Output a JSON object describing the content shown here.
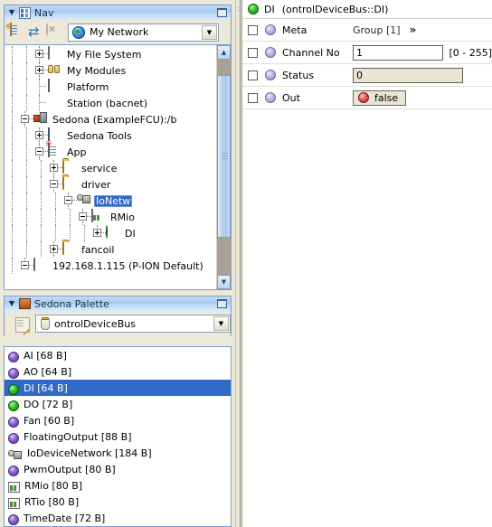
{
  "nav_panel": {
    "title": "Nav",
    "collapse_icon": "triangle-down-icon",
    "panel_icon": "nav-panel-icon",
    "maximize_icon": "maximize-icon",
    "toolbar": {
      "bookmark_icon": "bookmark-page-icon",
      "refresh_icon": "refresh-icon",
      "stop_icon": "stop-disabled-icon"
    },
    "location_combo": {
      "icon": "globe-icon",
      "value": "My Network",
      "arrow_icon": "chevron-down-icon"
    },
    "tree": [
      {
        "label": "My File System",
        "indent": 2,
        "expander": "plus",
        "icon": "drive-icon",
        "selected": false
      },
      {
        "label": "My Modules",
        "indent": 2,
        "expander": "plus",
        "icon": "modules-icon",
        "selected": false
      },
      {
        "label": "Platform",
        "indent": 2,
        "expander": "none",
        "icon": "stack-icon",
        "selected": false
      },
      {
        "label": "Station (bacnet)",
        "indent": 2,
        "expander": "none",
        "icon": "fox-icon",
        "selected": false
      },
      {
        "label": "Sedona (ExampleFCU):/b",
        "indent": 1,
        "expander": "minus",
        "icon": "sedona-icon",
        "selected": false
      },
      {
        "label": "Sedona Tools",
        "indent": 2,
        "expander": "plus",
        "icon": "stack-blue-icon",
        "selected": false
      },
      {
        "label": "App",
        "indent": 2,
        "expander": "minus",
        "icon": "app-icon",
        "selected": false
      },
      {
        "label": "service",
        "indent": 3,
        "expander": "plus",
        "icon": "folder-icon",
        "selected": false
      },
      {
        "label": "driver",
        "indent": 3,
        "expander": "minus",
        "icon": "folder-icon",
        "selected": false
      },
      {
        "label": "IoNetw",
        "indent": 4,
        "expander": "minus",
        "icon": "network-icon",
        "selected": true
      },
      {
        "label": "RMio",
        "indent": 5,
        "expander": "minus",
        "icon": "rmio-icon",
        "selected": false
      },
      {
        "label": "DI",
        "indent": 6,
        "expander": "plus",
        "icon": "green-dot-icon",
        "selected": false
      },
      {
        "label": "fancoil",
        "indent": 3,
        "expander": "plus",
        "icon": "folder-icon",
        "selected": false
      },
      {
        "label": "192.168.1.115 (P-ION Default)",
        "indent": 1,
        "expander": "minus",
        "icon": "printer-icon",
        "selected": false
      }
    ],
    "scrollbar": {
      "up_arrow": "scroll-up-icon",
      "down_arrow": "scroll-down-icon"
    }
  },
  "palette_panel": {
    "title": "Sedona Palette",
    "collapse_icon": "triangle-down-icon",
    "panel_icon": "palette-icon",
    "maximize_icon": "maximize-icon",
    "open_icon": "open-palette-icon",
    "kit_combo": {
      "icon": "kit-icon",
      "value": "ontrolDeviceBus",
      "arrow_icon": "chevron-down-icon"
    },
    "items": [
      {
        "label": "AI [68 B]",
        "icon": "purple-dot-icon",
        "selected": false
      },
      {
        "label": "AO [64 B]",
        "icon": "purple-dot-icon",
        "selected": false
      },
      {
        "label": "DI [64 B]",
        "icon": "green-dot-icon",
        "selected": true
      },
      {
        "label": "DO [72 B]",
        "icon": "green-dot-icon",
        "selected": false
      },
      {
        "label": "Fan [60 B]",
        "icon": "purple-dot-icon",
        "selected": false
      },
      {
        "label": "FloatingOutput [88 B]",
        "icon": "purple-dot-icon",
        "selected": false
      },
      {
        "label": "IoDeviceNetwork [184 B]",
        "icon": "network-icon",
        "selected": false
      },
      {
        "label": "PwmOutput [80 B]",
        "icon": "purple-dot-icon",
        "selected": false
      },
      {
        "label": "RMio [80 B]",
        "icon": "rmio-icon",
        "selected": false
      },
      {
        "label": "RTio [80 B]",
        "icon": "rmio-icon",
        "selected": false
      },
      {
        "label": "TimeDate [72 B]",
        "icon": "purple-dot-icon",
        "selected": false
      }
    ]
  },
  "property_sheet": {
    "header": {
      "icon": "green-dot-icon",
      "name": "DI",
      "type": "(ontrolDeviceBus::DI)"
    },
    "rows": [
      {
        "name": "Meta",
        "kind": "meta",
        "value": "Group [1]",
        "chevron": "»",
        "checked": false
      },
      {
        "name": "Channel No",
        "kind": "text",
        "value": "1",
        "range": "[0 - 255]",
        "readonly": false,
        "checked": false
      },
      {
        "name": "Status",
        "kind": "text",
        "value": "0",
        "range": "",
        "readonly": true,
        "checked": false
      },
      {
        "name": "Out",
        "kind": "bool",
        "value": "false",
        "indicator": "red-dot-icon",
        "checked": false
      }
    ]
  },
  "colors": {
    "selection_blue": "#316ac5",
    "title_bar_blue": "#a8c8ee",
    "panel_bg": "#ece9d8",
    "green_status": "#2fc225",
    "red_status": "#e05a5a",
    "purple_slot": "#8a5fd6"
  }
}
